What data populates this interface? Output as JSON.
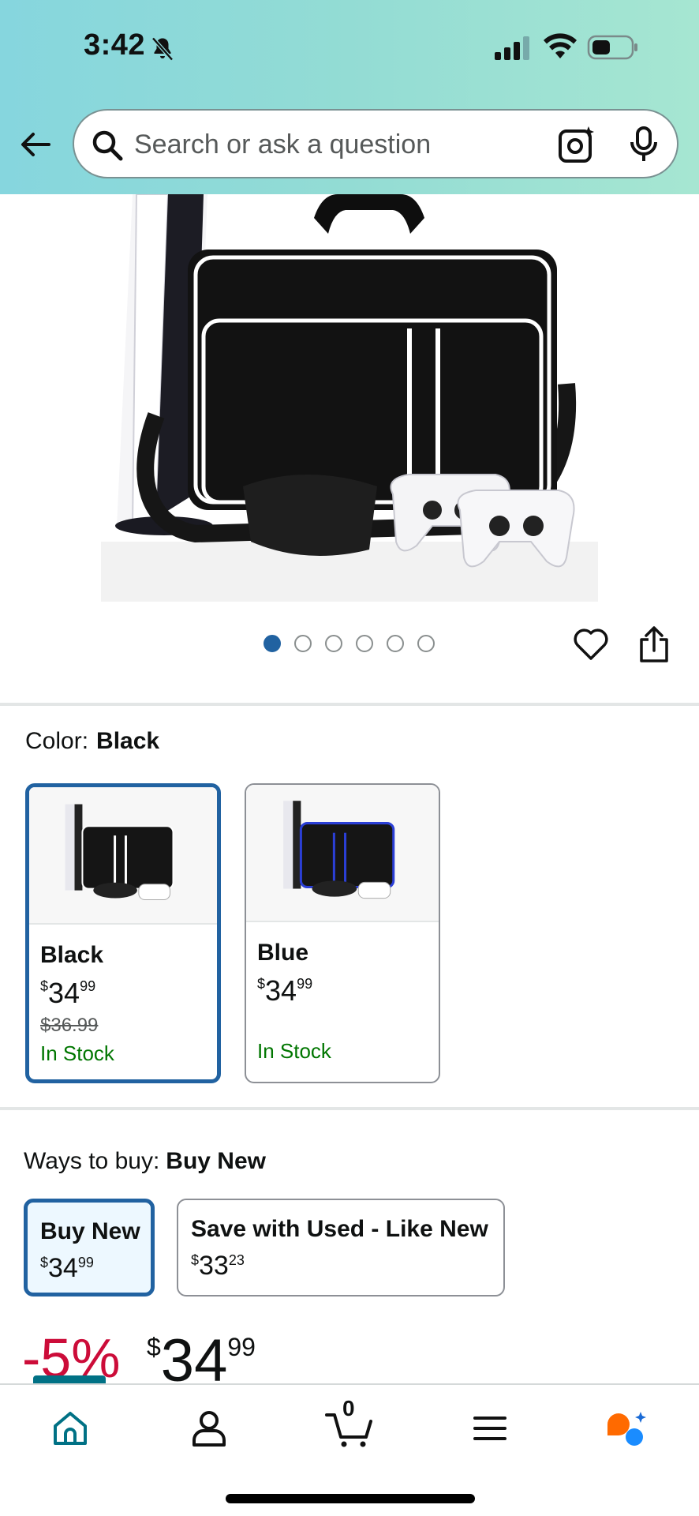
{
  "status_bar": {
    "time": "3:42"
  },
  "search": {
    "placeholder": "Search or ask a question"
  },
  "product": {
    "image_count": 6,
    "active_image": 1
  },
  "color": {
    "label": "Color:",
    "selected": "Black",
    "options": [
      {
        "name": "Black",
        "price_whole": "34",
        "price_cents": "99",
        "list_price": "$36.99",
        "stock": "In Stock",
        "accent": "#ffffff"
      },
      {
        "name": "Blue",
        "price_whole": "34",
        "price_cents": "99",
        "list_price": "",
        "stock": "In Stock",
        "accent": "#2b3fd6"
      }
    ]
  },
  "ways_to_buy": {
    "label": "Ways to buy:",
    "selected": "Buy New",
    "options": [
      {
        "title": "Buy New",
        "price_whole": "34",
        "price_cents": "99"
      },
      {
        "title": "Save with Used - Like New",
        "price_whole": "33",
        "price_cents": "23"
      }
    ]
  },
  "price": {
    "discount": "-5%",
    "currency": "$",
    "whole": "34",
    "cents": "99"
  },
  "currency_symbol": "$",
  "bottom_nav": {
    "cart_count": "0"
  },
  "colors": {
    "link_blue": "#2162a1",
    "deal_red": "#cc0c39",
    "stock_green": "#007600",
    "teal": "#007185"
  }
}
